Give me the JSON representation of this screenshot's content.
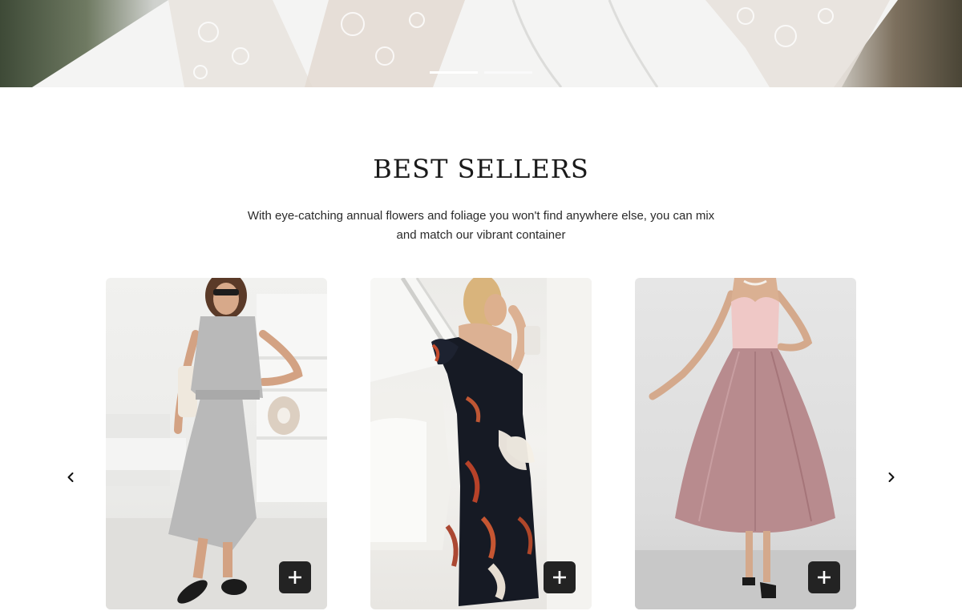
{
  "hero": {
    "slides": [
      {
        "active": true
      },
      {
        "active": false
      }
    ]
  },
  "best_sellers": {
    "title": "BEST SELLERS",
    "description": "With eye-catching annual flowers and foliage you won't find anywhere else, you can mix and match our vibrant container"
  },
  "carousel": {
    "prev_icon": "chevron-left-icon",
    "next_icon": "chevron-right-icon",
    "products": [
      {
        "image": "grey-sleeveless-midi-dress",
        "add_icon": "plus-icon"
      },
      {
        "image": "floral-off-shoulder-maxi-dress",
        "add_icon": "plus-icon"
      },
      {
        "image": "pink-tulle-corset-dress",
        "add_icon": "plus-icon"
      }
    ]
  },
  "colors": {
    "add_button_bg": "#232323",
    "heading_text": "#1a1a1a",
    "body_text": "#2a2a2a"
  }
}
